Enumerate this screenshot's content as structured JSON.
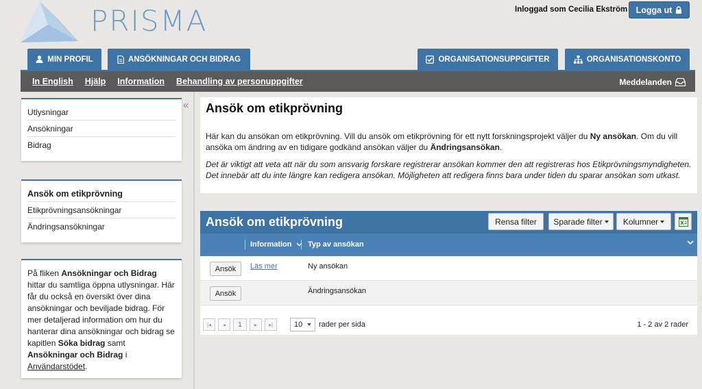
{
  "header": {
    "brand": "PRISMA",
    "logged_in_as": "Inloggad som Cecilia Ekström",
    "logout_label": "Logga ut"
  },
  "tabs": [
    {
      "label": "MIN PROFIL",
      "icon": "user-icon"
    },
    {
      "label": "ANSÖKNINGAR OCH BIDRAG",
      "icon": "document-icon"
    },
    {
      "label": "ORGANISATIONSUPPGIFTER",
      "icon": "checkbox-icon"
    },
    {
      "label": "ORGANISATIONSKONTO",
      "icon": "org-chart-icon"
    }
  ],
  "subnav": {
    "links": [
      "In English",
      "Hjälp",
      "Information",
      "Behandling av personuppgifter"
    ],
    "messages": "Meddelanden"
  },
  "sidebar": {
    "panel1": [
      "Utlysningar",
      "Ansökningar",
      "Bidrag"
    ],
    "panel2": {
      "heading": "Ansök om etikprövning",
      "items": [
        "Etikprövningsansökningar",
        "Ändringsansökningar"
      ]
    },
    "help": {
      "t1": "På fliken ",
      "b1": "Ansökningar och Bidrag",
      "t2": " hittar du samtliga öppna utlysningar. Här får du också en översikt över dina ansökningar och beviljade bidrag. För mer detaljerad information om hur du hanterar dina ansökningar och bidrag se kapitlen ",
      "b2": "Söka bidrag",
      "t3": " samt ",
      "b3": "Ansökningar och Bidrag",
      "t4": " i ",
      "link": "Användarstödet",
      "t5": "."
    }
  },
  "intro": {
    "title": "Ansök om etikprövning",
    "p1_a": "Här kan du ansökan om etikprövning. Vill du ansök om etikprövning för ett nytt forskningsprojekt väljer du ",
    "p1_b": "Ny ansökan",
    "p1_c": ". Om du vill ansöka om ändring av en tidigare godkänd ansökan väljer du ",
    "p1_d": "Ändringsansökan",
    "p1_e": ".",
    "note": "Det är viktigt att veta att när du som ansvarig forskare registrerar ansökan kommer den att registreras hos Etikprövningsmyndigheten. Det innebär att du inte längre kan redigera ansökan. Möjligheten att redigera finns bara under tiden du sparar ansökan som utkast."
  },
  "grid": {
    "title": "Ansök om etikprövning",
    "buttons": {
      "rensa": "Rensa filter",
      "sparade": "Sparade filter",
      "kolumner": "Kolumner"
    },
    "columns": {
      "info": "Information",
      "typ": "Typ av ansökan"
    },
    "rows": [
      {
        "action": "Ansök",
        "info_link": "Läs mer",
        "typ": "Ny ansökan"
      },
      {
        "action": "Ansök",
        "info_link": "",
        "typ": "Ändringsansökan"
      }
    ],
    "pager": {
      "page": "1",
      "page_size": "10",
      "per_page_label": "rader per sida",
      "total": "1 - 2 av 2 rader"
    }
  }
}
